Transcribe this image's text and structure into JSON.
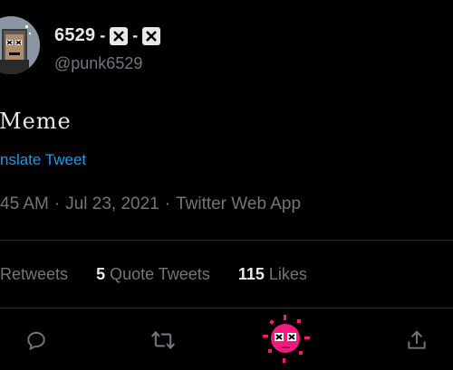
{
  "author": {
    "display_name": "6529",
    "name_dash_1": "-",
    "name_dash_2": "-",
    "handle": "@punk6529",
    "avatar_icon": "cryptopunk-avatar-icon",
    "name_emoji_icon": "x-box-emoji-icon"
  },
  "tweet": {
    "text": "Meme",
    "translate_label": "nslate Tweet"
  },
  "meta": {
    "time": "45 AM",
    "date": "Jul 23, 2021",
    "source": "Twitter Web App",
    "separator": "·"
  },
  "stats": {
    "retweets_label": "Retweets",
    "quote_count": "5",
    "quote_label": "Quote Tweets",
    "likes_count": "115",
    "likes_label": "Likes"
  },
  "actions": {
    "reply_icon": "reply-icon",
    "retweet_icon": "retweet-icon",
    "like_icon": "punk-like-animation-icon",
    "share_icon": "share-icon"
  },
  "colors": {
    "background": "#000000",
    "text_primary": "#e7e9ea",
    "text_secondary": "#71767b",
    "link": "#1d9bf0",
    "like_pink": "#f91880",
    "divider": "#2f3336"
  }
}
